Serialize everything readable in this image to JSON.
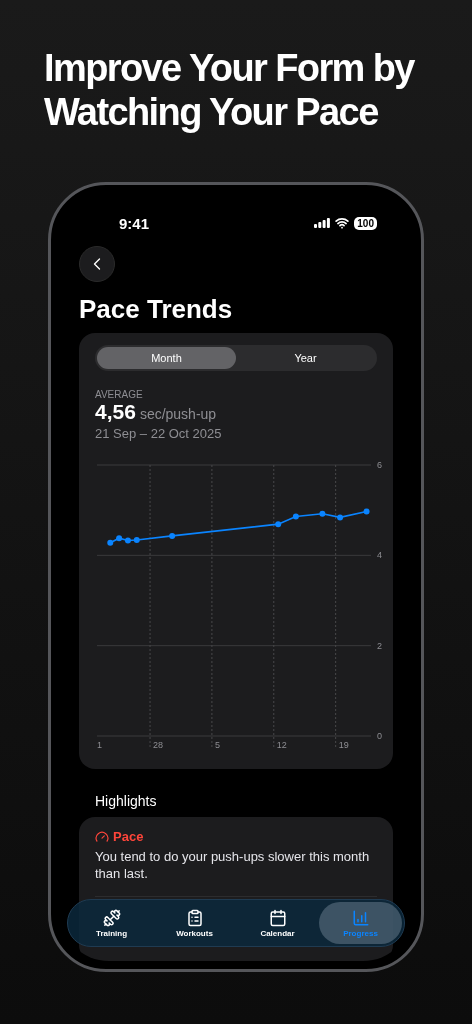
{
  "headline": "Improve Your Form by Watching Your Pace",
  "status_bar": {
    "time": "9:41",
    "battery": "100"
  },
  "title": "Pace Trends",
  "segments": [
    {
      "label": "Month",
      "selected": true
    },
    {
      "label": "Year",
      "selected": false
    }
  ],
  "summary": {
    "label": "AVERAGE",
    "value": "4,56",
    "unit": "sec/push-up",
    "range": "21 Sep – 22 Oct 2025"
  },
  "chart_data": {
    "type": "line",
    "categories": [
      "1",
      null,
      null,
      null,
      null,
      null,
      "28",
      null,
      null,
      null,
      null,
      null,
      null,
      "5",
      null,
      null,
      null,
      null,
      null,
      null,
      "12",
      null,
      null,
      null,
      null,
      null,
      null,
      "19",
      null,
      null,
      null
    ],
    "grid": true,
    "series": [
      {
        "color": "#0a84ff",
        "marker": true,
        "values": [
          null,
          4.28,
          4.38,
          4.33,
          4.34,
          null,
          null,
          null,
          4.43,
          null,
          null,
          null,
          null,
          null,
          null,
          null,
          null,
          null,
          null,
          null,
          4.69,
          null,
          4.86,
          null,
          null,
          4.92,
          null,
          4.84,
          null,
          null,
          4.97
        ]
      }
    ],
    "ylim": [
      0,
      6
    ],
    "yticks": [
      0,
      2,
      4,
      6
    ]
  },
  "highlights": {
    "title": "Highlights",
    "items": [
      {
        "title": "Pace",
        "text": "You tend to do your push-ups slower this month than last."
      }
    ]
  },
  "tabs": [
    {
      "label": "Training",
      "selected": false
    },
    {
      "label": "Workouts",
      "selected": false
    },
    {
      "label": "Calendar",
      "selected": false
    },
    {
      "label": "Progress",
      "selected": true
    }
  ]
}
